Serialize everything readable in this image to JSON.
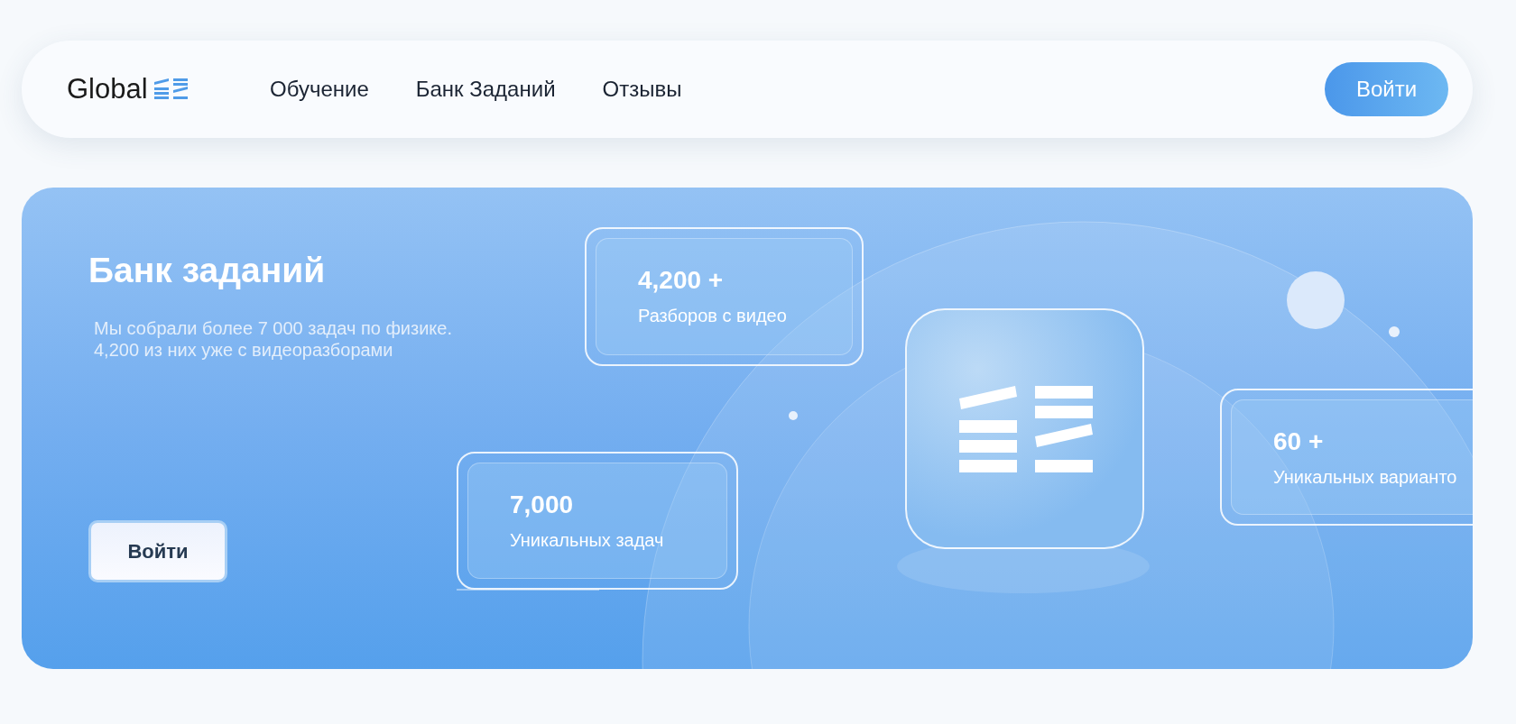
{
  "header": {
    "logo_text": "Global",
    "nav": [
      {
        "label": "Обучение"
      },
      {
        "label": "Банк Заданий"
      },
      {
        "label": "Отзывы"
      }
    ],
    "login_button": "Войти"
  },
  "hero": {
    "title": "Банк заданий",
    "description": [
      "Мы собрали более 7 000 задач по физике.",
      "4,200 из них уже с видеоразборами"
    ],
    "button": "Войти",
    "stats": [
      {
        "value": "4,200 +",
        "label": "Разборов с видео"
      },
      {
        "value": "7,000",
        "label": "Уникальных задач"
      },
      {
        "value": "60 +",
        "label": "Уникальных варианто"
      }
    ]
  }
}
